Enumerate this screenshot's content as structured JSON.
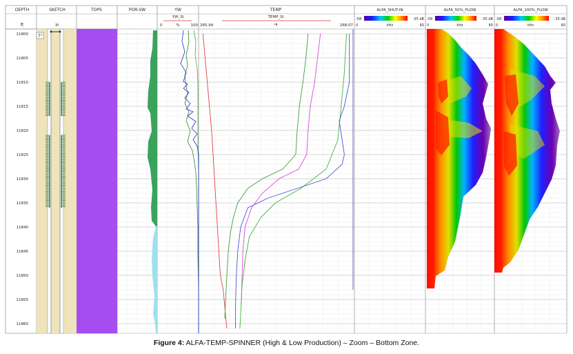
{
  "chart_data": {
    "type": "well-log",
    "depth_track": {
      "header": "DEPTH",
      "unit": "ft",
      "ticks": [
        11800,
        11805,
        11810,
        11815,
        11820,
        11825,
        11830,
        11835,
        11840,
        11845,
        11850,
        11855,
        11860
      ],
      "range": [
        11799,
        11862
      ]
    },
    "tracks": {
      "sketch": {
        "header": "SKETCH",
        "unit": "in",
        "tag": "7\""
      },
      "tops": {
        "header": "TOPS"
      },
      "por_sw": {
        "header": "POR-SW"
      },
      "yw": {
        "header": "YW",
        "curve": "YW_SI",
        "unit": "%",
        "min": "0",
        "max": "100"
      },
      "temp": {
        "header": "TEMP",
        "curve": "TEMP_SI",
        "unit": "°F",
        "min": "265.94",
        "max": "268.07"
      },
      "alfa": [
        {
          "header": "ALFA_SHUT-IN",
          "db_min": "-58",
          "db_max": "-35 dB",
          "unit": "kHz",
          "f_min": "0",
          "f_max": "60",
          "active": false
        },
        {
          "header": "ALFA_50%_FLOW",
          "db_min": "-58",
          "db_max": "-35 dB",
          "unit": "kHz",
          "f_min": "0",
          "f_max": "60",
          "active": true
        },
        {
          "header": "ALFA_100%_FLOW",
          "db_min": "-58",
          "db_max": "-35 dB",
          "unit": "kHz",
          "f_min": "0",
          "f_max": "60",
          "active": true
        }
      ]
    },
    "perforations": [
      [
        11810,
        11817
      ],
      [
        11821,
        11836
      ]
    ],
    "temp_series": [
      {
        "color": "#e04040",
        "depths": [
          11800,
          11810,
          11820,
          11830,
          11840,
          11850,
          11853,
          11858,
          11861
        ],
        "values": [
          266.0,
          266.06,
          266.12,
          266.16,
          266.2,
          266.24,
          266.28,
          266.31,
          266.33
        ]
      },
      {
        "color": "#3cb43c",
        "depths": [
          11800,
          11808,
          11816,
          11822,
          11828,
          11832,
          11835,
          11838,
          11842,
          11847,
          11852,
          11858,
          11861
        ],
        "values": [
          267.98,
          267.95,
          267.9,
          267.86,
          267.7,
          267.35,
          267.0,
          266.8,
          266.64,
          266.58,
          266.54,
          266.52,
          266.51
        ]
      },
      {
        "color": "#5050d8",
        "depths": [
          11800,
          11810,
          11815,
          11818,
          11822,
          11825,
          11827,
          11830,
          11832,
          11834,
          11836,
          11840,
          11845,
          11850,
          11856,
          11861
        ],
        "values": [
          268.02,
          268.02,
          267.95,
          267.88,
          267.92,
          267.95,
          267.92,
          267.7,
          267.3,
          266.9,
          266.62,
          266.52,
          266.48,
          266.46,
          266.45,
          266.45
        ]
      },
      {
        "color": "#d848d8",
        "depths": [
          11800,
          11805,
          11810,
          11815,
          11820,
          11825,
          11828,
          11830,
          11833,
          11836,
          11840,
          11845,
          11850,
          11856
        ],
        "values": [
          267.62,
          267.58,
          267.54,
          267.48,
          267.45,
          267.43,
          267.32,
          267.05,
          266.82,
          266.67,
          266.58,
          266.55,
          266.54,
          266.53
        ]
      },
      {
        "color": "#3ca03c",
        "depths": [
          11800,
          11805,
          11810,
          11815,
          11820,
          11825,
          11828,
          11830,
          11832,
          11835,
          11838,
          11841,
          11845,
          11850,
          11856,
          11859
        ],
        "values": [
          267.45,
          267.42,
          267.38,
          267.33,
          267.3,
          267.28,
          267.1,
          266.82,
          266.62,
          266.48,
          266.42,
          266.38,
          266.35,
          266.33,
          266.31,
          266.3
        ]
      }
    ]
  },
  "caption": {
    "label": "Figure 4:",
    "text": " ALFA-TEMP-SPINNER (High & Low Production) – Zoom – Bottom Zone."
  }
}
